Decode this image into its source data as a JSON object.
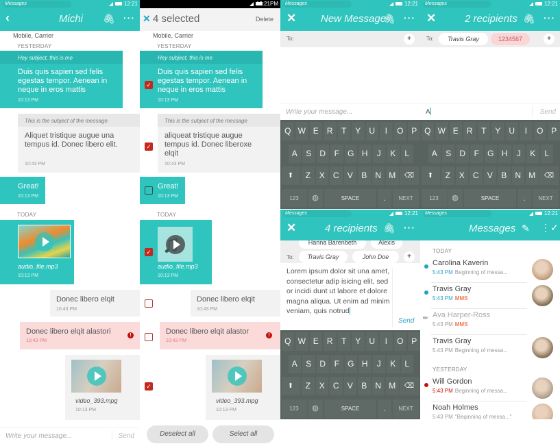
{
  "colors": {
    "accent": "#2fc4bd",
    "error": "#c5281d",
    "keyboard": "#58625f",
    "unread": "#1ea3c4",
    "failed": "#c5100a",
    "mms": "#f07a50"
  },
  "status": {
    "app": "Messages",
    "time": "12:21",
    "time_selected": "12:21PM"
  },
  "thread": {
    "title": "Michi",
    "carrier": "Mobile, Carrier",
    "yesterday": "YESTERDAY",
    "today": "TODAY",
    "m1": {
      "subject": "Hey subject, this is me",
      "body": "Duis quis sapien sed felis egestas tempor. Aenean in neque in eros mattis",
      "time": "10:13 PM"
    },
    "m2": {
      "subject": "This is the subject of the message",
      "body": "Aliquet tristique augue una tempus id. Donec libero elit.",
      "body_sel": "aliqueat tristique augue tempus id. Donec liberoxe elqit",
      "time": "10:43 PM"
    },
    "m3": {
      "body": "Great!",
      "time": "10:13 PM"
    },
    "m4": {
      "file": "audio_file.mp3",
      "time": "10:13 PM"
    },
    "m5": {
      "body": "Donec libero elqit",
      "time": "10:43 PM"
    },
    "m6": {
      "body": "Donec libero elqit alastori",
      "body_sel": "Donec libero elqit alastor",
      "time": "10:43 PM"
    },
    "m7": {
      "file": "video_393.mpg",
      "time": "10:13 PM"
    },
    "placeholder": "Write your message...",
    "send": "Send"
  },
  "selection": {
    "title": "4 selected",
    "delete": "Delete",
    "deselect_all": "Deselect all",
    "select_all": "Select all",
    "checked": [
      true,
      true,
      false,
      true,
      false,
      false,
      true
    ]
  },
  "new_message": {
    "title": "New Message",
    "to": "To:",
    "placeholder": "Write your message..."
  },
  "two_recipients": {
    "title": "2 recipients",
    "to": "To:",
    "chips": [
      "Travis Gray",
      "1234567"
    ],
    "draft": "A",
    "send": "Send"
  },
  "four_recipients": {
    "title": "4 recipients",
    "to": "To:",
    "hidden_chips": [
      "Hanna Barenbeth",
      "Alexis"
    ],
    "chips": [
      "Travis Gray",
      "John Doe"
    ],
    "draft": "Lorem ipsum dolor sit una amet, consectetur adip isicing elit, sed or incidi dunt ut labore et dolore magna aliqua. Ut enim ad minim veniam, quis notrud",
    "send": "Send"
  },
  "keyboard": {
    "rows": [
      [
        "Q",
        "W",
        "E",
        "R",
        "T",
        "Y",
        "U",
        "I",
        "O",
        "P"
      ],
      [
        "A",
        "S",
        "D",
        "F",
        "G",
        "H",
        "J",
        "K",
        "L"
      ],
      [
        "Z",
        "X",
        "C",
        "V",
        "B",
        "N",
        "M"
      ]
    ],
    "num": "123",
    "space": "SPACE",
    "period": ".",
    "next": "NEXT"
  },
  "inbox": {
    "title": "Messages",
    "groups": [
      {
        "label": "TODAY",
        "items": [
          {
            "name": "Carolina Kaverin",
            "time": "5:43 PM",
            "preview": "Beginning of messa...",
            "state": "unread",
            "avatar": true
          },
          {
            "name": "Travis Gray",
            "time": "5:43 PM",
            "preview": "MMS",
            "state": "unread",
            "mms": true,
            "avatar": true
          },
          {
            "name": "Ava Harper-Ross",
            "time": "5:43 PM",
            "preview": "MMS",
            "state": "draft",
            "mms": true,
            "avatar": false
          },
          {
            "name": "Travis Gray",
            "time": "5:43 PM",
            "preview": "Beginning of messa...",
            "state": "read",
            "avatar": true
          }
        ]
      },
      {
        "label": "YESTERDAY",
        "items": [
          {
            "name": "Will Gordon",
            "time": "5:43 PM",
            "preview": "Beginning of messa...",
            "state": "failed",
            "avatar": true
          },
          {
            "name": "Noah Holmes",
            "time": "5:43 PM",
            "preview": "\"Beginning of messa...\"",
            "state": "read",
            "avatar": true
          }
        ]
      }
    ]
  }
}
